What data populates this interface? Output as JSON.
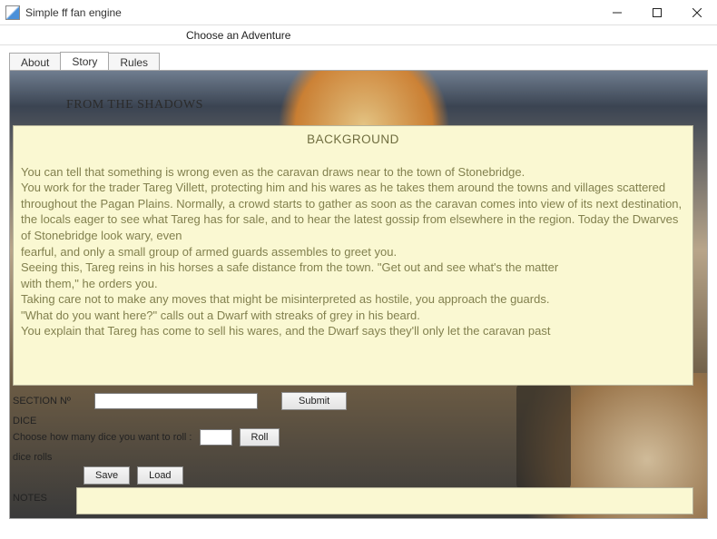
{
  "window": {
    "title": "Simple ff fan engine"
  },
  "menubar": {
    "choose_adventure": "Choose an Adventure"
  },
  "tabs": {
    "about": "About",
    "story": "Story",
    "rules": "Rules",
    "active": "Story"
  },
  "adventure": {
    "title": "FROM THE SHADOWS"
  },
  "story": {
    "heading": "BACKGROUND",
    "body": "You can tell that something is wrong even as the caravan draws near to the town of Stonebridge.\nYou work for the trader Tareg Villett, protecting him and his wares as he takes them around the towns and villages scattered throughout the Pagan Plains. Normally, a crowd starts to gather as soon as the caravan comes into view of its next destination, the locals eager to see what Tareg has for sale, and to hear the latest gossip from elsewhere in the region. Today the Dwarves of Stonebridge look wary, even\nfearful, and only a small group of armed guards assembles to greet you.\nSeeing this, Tareg reins in his horses a safe distance from the town. \"Get out and see what's the matter\nwith them,\" he orders you.\nTaking care not to make any moves that might be misinterpreted as hostile, you approach the guards.\n\"What do you want here?\" calls out a Dwarf with streaks of grey in his beard.\nYou explain that Tareg has come to sell his wares, and the Dwarf says they'll only let the caravan past"
  },
  "controls": {
    "section_label": "SECTION Nº",
    "section_value": "",
    "submit_label": "Submit",
    "dice_label": "DICE",
    "dice_prompt": "Choose how many dice you want to roll :",
    "dice_value": "",
    "roll_label": "Roll",
    "dice_rolls_label": "dice rolls",
    "notes_label": "NOTES",
    "save_label": "Save",
    "load_label": "Load",
    "notes_value": ""
  }
}
